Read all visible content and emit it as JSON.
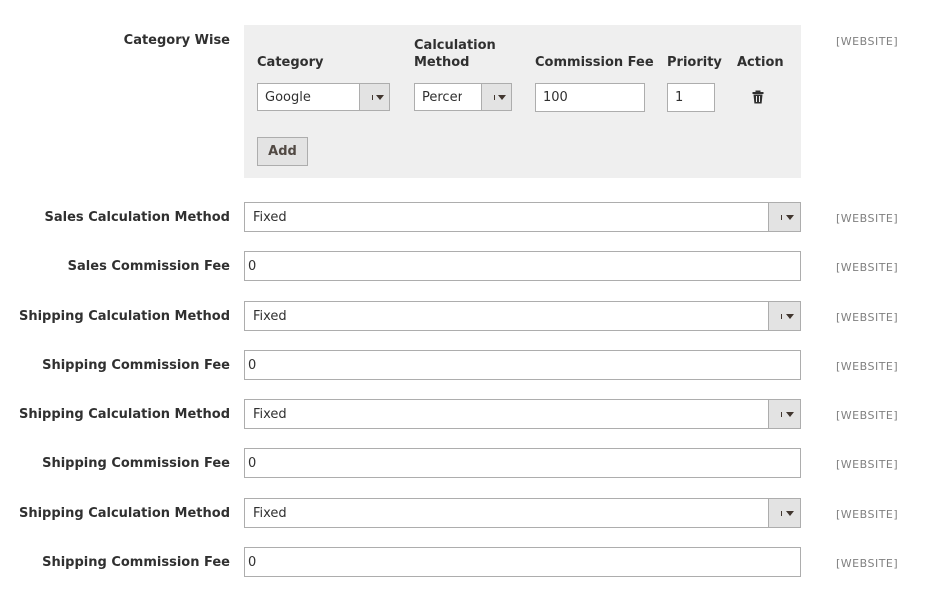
{
  "category_wise": {
    "label": "Category Wise",
    "scope": "[WEBSITE]",
    "headers": {
      "category": "Category",
      "calc_method_line1": "Calculation",
      "calc_method_line2": "Method",
      "commission_fee": "Commission Fee",
      "priority": "Priority",
      "action": "Action"
    },
    "row": {
      "category": "Google",
      "calc_method": "Percer",
      "commission_fee": "100",
      "priority": "1"
    },
    "add_label": "Add",
    "trash_icon": "trash-icon"
  },
  "fields": [
    {
      "label": "Sales Calculation Method",
      "type": "select",
      "value": "Fixed",
      "scope": "[WEBSITE]"
    },
    {
      "label": "Sales Commission Fee",
      "type": "input",
      "value": "0",
      "scope": "[WEBSITE]"
    },
    {
      "label": "Shipping Calculation Method",
      "type": "select",
      "value": "Fixed",
      "scope": "[WEBSITE]"
    },
    {
      "label": "Shipping Commission Fee",
      "type": "input",
      "value": "0",
      "scope": "[WEBSITE]"
    },
    {
      "label": "Shipping Calculation Method",
      "type": "select",
      "value": "Fixed",
      "scope": "[WEBSITE]"
    },
    {
      "label": "Shipping Commission Fee",
      "type": "input",
      "value": "0",
      "scope": "[WEBSITE]"
    },
    {
      "label": "Shipping Calculation Method",
      "type": "select",
      "value": "Fixed",
      "scope": "[WEBSITE]"
    },
    {
      "label": "Shipping Commission Fee",
      "type": "input",
      "value": "0",
      "scope": "[WEBSITE]"
    }
  ]
}
